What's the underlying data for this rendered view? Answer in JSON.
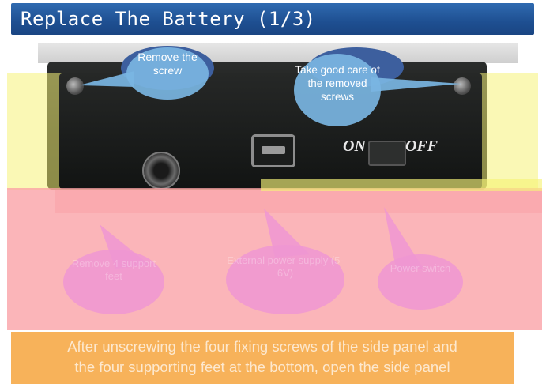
{
  "header": {
    "title": "Replace The Battery  (1/3)"
  },
  "photo": {
    "switch_on_label": "ON",
    "switch_off_label": "OFF"
  },
  "callouts": {
    "remove_screw": "Remove the screw",
    "take_care": "Take good care of the removed screws",
    "remove_feet": "Remove 4 support feet",
    "external_power": "External power supply (5-6V)",
    "power_switch": "Power switch"
  },
  "caption": {
    "line1": "After unscrewing the four fixing screws of the side panel and",
    "line2": "the four supporting feet at the bottom, open the side panel"
  },
  "colors": {
    "title_bar": "#1e4f91",
    "callout_blue": "#79b5e2",
    "callout_pink": "#ee96d2",
    "caption_orange": "#f7b25a",
    "highlight_yellow": "#f6f378",
    "highlight_pink": "#faa0a5"
  }
}
